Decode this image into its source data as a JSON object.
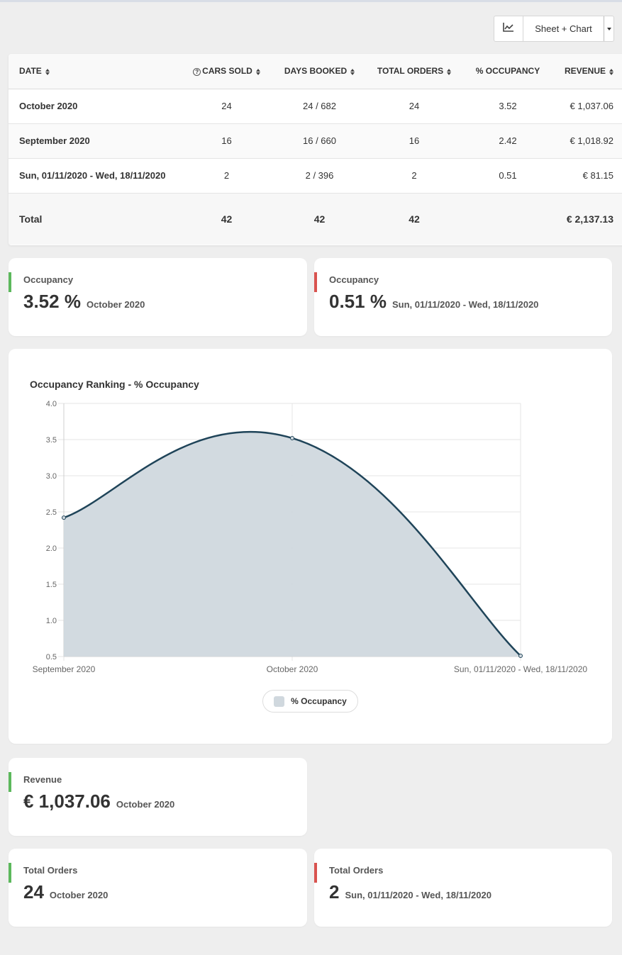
{
  "toolbar": {
    "view_icon": "line-chart-icon",
    "view_label": "Sheet + Chart"
  },
  "table": {
    "headers": {
      "date": "DATE",
      "cars_sold": "CARS SOLD",
      "days_booked": "DAYS BOOKED",
      "total_orders": "TOTAL ORDERS",
      "occupancy": "% OCCUPANCY",
      "revenue": "REVENUE"
    },
    "rows": [
      {
        "date": "October 2020",
        "cars_sold": "24",
        "days_booked": "24 / 682",
        "total_orders": "24",
        "occupancy": "3.52",
        "revenue": "€ 1,037.06"
      },
      {
        "date": "September 2020",
        "cars_sold": "16",
        "days_booked": "16 / 660",
        "total_orders": "16",
        "occupancy": "2.42",
        "revenue": "€ 1,018.92"
      },
      {
        "date": "Sun, 01/11/2020 - Wed, 18/11/2020",
        "cars_sold": "2",
        "days_booked": "2 / 396",
        "total_orders": "2",
        "occupancy": "0.51",
        "revenue": "€ 81.15"
      }
    ],
    "total": {
      "label": "Total",
      "cars_sold": "42",
      "days_booked": "42",
      "total_orders": "42",
      "occupancy": "",
      "revenue": "€ 2,137.13"
    }
  },
  "cards": {
    "occ_best": {
      "title": "Occupancy",
      "value": "3.52 %",
      "period": "October 2020",
      "color": "#5cb85c"
    },
    "occ_worst": {
      "title": "Occupancy",
      "value": "0.51 %",
      "period": "Sun, 01/11/2020 - Wed, 18/11/2020",
      "color": "#d9534f"
    },
    "rev_best": {
      "title": "Revenue",
      "value": "€ 1,037.06",
      "period": "October 2020",
      "color": "#5cb85c"
    },
    "orders_best": {
      "title": "Total Orders",
      "value": "24",
      "period": "October 2020",
      "color": "#5cb85c"
    },
    "orders_worst": {
      "title": "Total Orders",
      "value": "2",
      "period": "Sun, 01/11/2020 - Wed, 18/11/2020",
      "color": "#d9534f"
    }
  },
  "chart_data": {
    "type": "area",
    "title": "Occupancy Ranking - % Occupancy",
    "categories": [
      "September 2020",
      "October 2020",
      "Sun, 01/11/2020 - Wed, 18/11/2020"
    ],
    "series": [
      {
        "name": "% Occupancy",
        "values": [
          2.42,
          3.52,
          0.51
        ],
        "color": "#1f4459",
        "fill": "#d0d8de"
      }
    ],
    "ylim": [
      0.5,
      4.0
    ],
    "yticks": [
      "0.5",
      "1.0",
      "1.5",
      "2.0",
      "2.5",
      "3.0",
      "3.5",
      "4.0"
    ],
    "grid": true,
    "legend": "bottom"
  }
}
